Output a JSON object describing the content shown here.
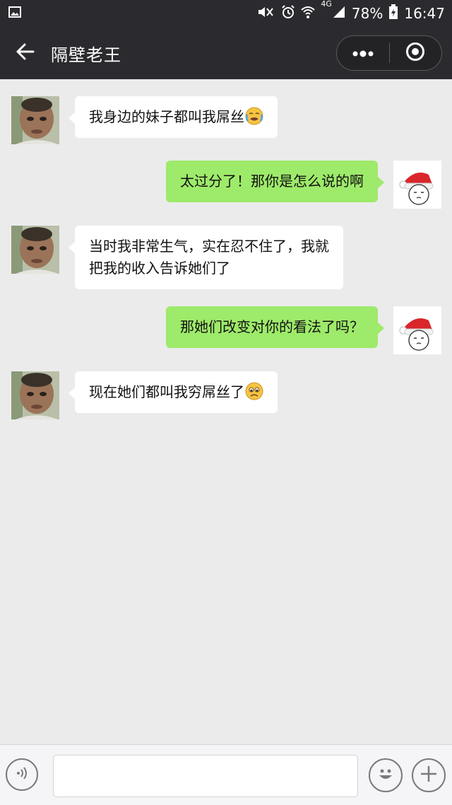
{
  "status_bar": {
    "battery_percent": "78%",
    "time": "16:47",
    "network": "4G",
    "icons": [
      "image-icon",
      "mute-vibrate-icon",
      "alarm-icon",
      "wifi-icon",
      "signal-icon",
      "battery-charging-icon"
    ]
  },
  "header": {
    "title": "隔壁老王",
    "back_icon": "back-arrow-icon",
    "more_icon": "more-dots-icon",
    "close_icon": "close-target-icon"
  },
  "messages": [
    {
      "side": "left",
      "sender": "other",
      "text": "我身边的妹子都叫我屌丝",
      "emoji": "crying-emoji"
    },
    {
      "side": "right",
      "sender": "me",
      "text": "太过分了！那你是怎么说的啊",
      "emoji": ""
    },
    {
      "side": "left",
      "sender": "other",
      "line1": "当时我非常生气，实在忍不住了，我就",
      "line2": "把我的收入告诉她们了",
      "emoji": ""
    },
    {
      "side": "right",
      "sender": "me",
      "text": "那她们改变对你的看法了吗？",
      "emoji": ""
    },
    {
      "side": "left",
      "sender": "other",
      "text": "现在她们都叫我穷屌丝了",
      "emoji": "sad-emoji"
    }
  ],
  "input_bar": {
    "voice_icon": "voice-icon",
    "emoji_icon": "emoji-icon",
    "plus_icon": "plus-icon",
    "text_value": ""
  },
  "colors": {
    "header_bg": "#2b2b2f",
    "chat_bg": "#ebebeb",
    "my_bubble": "#9eea6a",
    "their_bubble": "#ffffff"
  }
}
